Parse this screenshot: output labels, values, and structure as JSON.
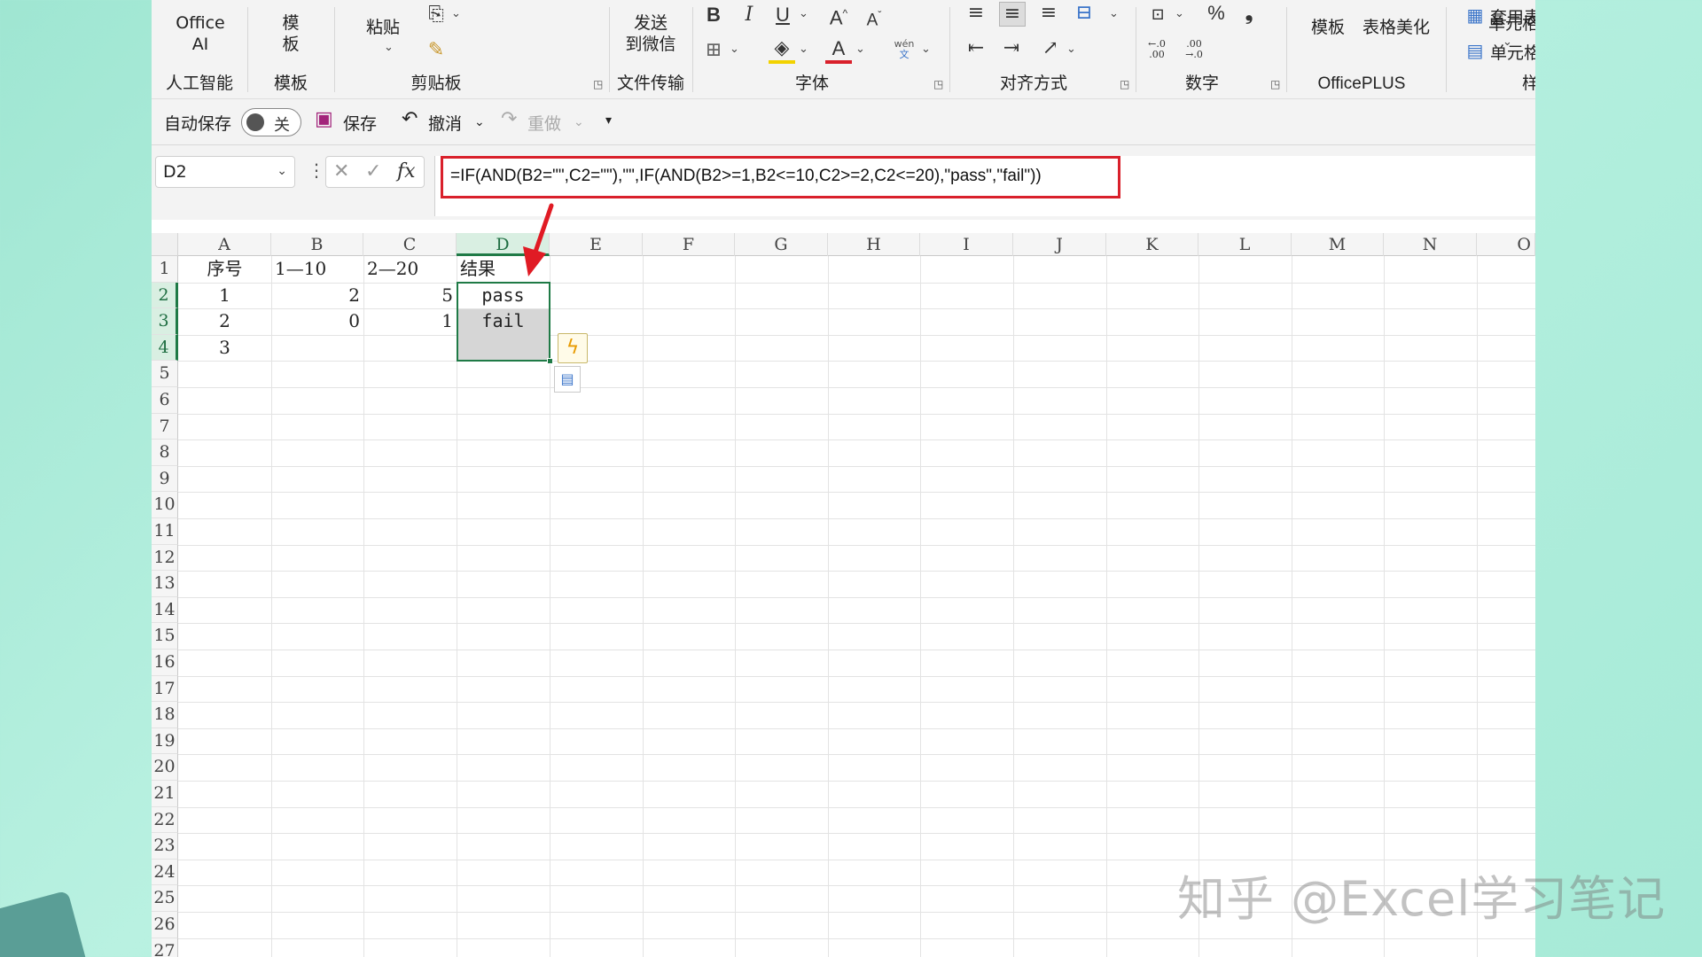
{
  "ribbon": {
    "office_ai": {
      "line1": "Office",
      "line2": "AI",
      "group": "人工智能"
    },
    "template_btn": {
      "line1": "模",
      "line2": "板",
      "group": "模板"
    },
    "clipboard": {
      "paste": "粘贴",
      "group": "剪贴板"
    },
    "send": {
      "line1": "发送",
      "line2": "到微信",
      "group": "文件传输"
    },
    "font": {
      "bold": "B",
      "italic": "I",
      "underline": "U",
      "wen": "wén",
      "wen_sub": "文",
      "group": "字体"
    },
    "alignment": {
      "group": "对齐方式"
    },
    "number": {
      "percent": "%",
      "comma": "❟",
      "inc": "←.0 .00",
      "dec": ".00 →.0",
      "group": "数字"
    },
    "officeplus": {
      "template": "模板",
      "beautify": "表格美化",
      "group": "OfficePLUS"
    },
    "styles": {
      "table_format": "套用表格格式",
      "cell_style": "单元格样式",
      "group": "样式"
    },
    "cells": {
      "label": "单元格"
    }
  },
  "qat": {
    "autosave": "自动保存",
    "autosave_state": "关",
    "save": "保存",
    "undo": "撤消",
    "redo": "重做"
  },
  "formula_bar": {
    "name_box": "D2",
    "formula": "=IF(AND(B2=\"\",C2=\"\"),\"\",IF(AND(B2>=1,B2<=10,C2>=2,C2<=20),\"pass\",\"fail\"))",
    "fx": "fx"
  },
  "sheet": {
    "columns": [
      "A",
      "B",
      "C",
      "D",
      "E",
      "F",
      "G",
      "H",
      "I",
      "J",
      "K",
      "L",
      "M",
      "N",
      "O"
    ],
    "rows": [
      "1",
      "2",
      "3",
      "4",
      "5",
      "6",
      "7",
      "8",
      "9",
      "10",
      "11",
      "12",
      "13",
      "14",
      "15",
      "16",
      "17",
      "18",
      "19",
      "20",
      "21",
      "22",
      "23",
      "24",
      "25",
      "26",
      "27"
    ],
    "headers": {
      "A1": "序号",
      "B1": "1—10",
      "C1": "2—20",
      "D1": "结果"
    },
    "data": {
      "A2": "1",
      "B2": "2",
      "C2": "5",
      "D2": "pass",
      "A3": "2",
      "B3": "0",
      "C3": "1",
      "D3": "fail",
      "A4": "3"
    }
  },
  "watermark": "知乎 @Excel学习笔记",
  "colors": {
    "accent_green": "#1f7a46",
    "highlight_red": "#d9202b"
  }
}
